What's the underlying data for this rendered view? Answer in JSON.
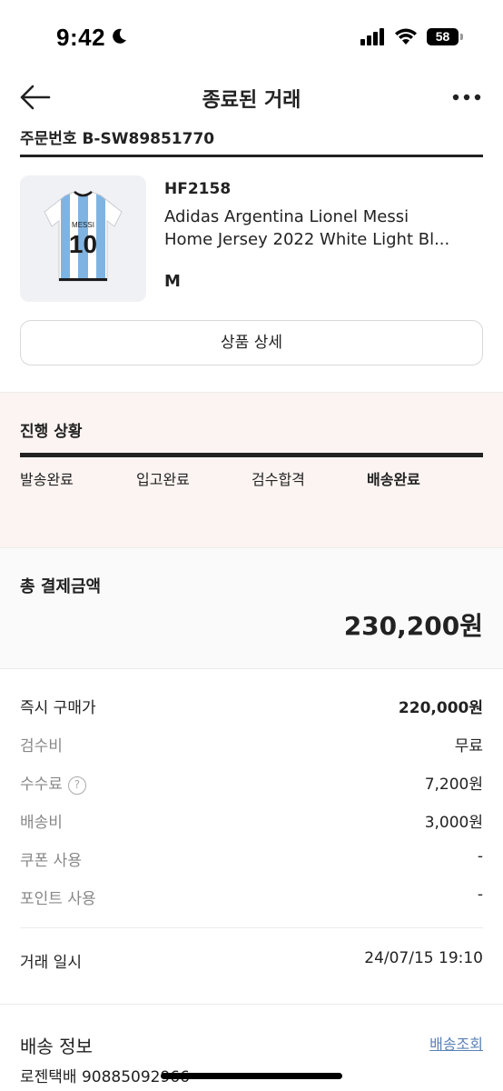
{
  "status_bar": {
    "time": "9:42",
    "battery": "58"
  },
  "header": {
    "title": "종료된 거래",
    "back_icon": "arrow-left-icon",
    "more_icon": "more-horizontal-icon"
  },
  "order": {
    "number_label": "주문번호 B-SW89851770"
  },
  "product": {
    "code": "HF2158",
    "name_line1": "Adidas Argentina Lionel Messi",
    "name_line2": "Home Jersey 2022 White Light Bl...",
    "size": "M",
    "jersey_name": "MESSI",
    "jersey_number": "10",
    "detail_button": "상품 상세"
  },
  "progress": {
    "title": "진행 상황",
    "steps": [
      "발송완료",
      "입고완료",
      "검수합격",
      "배송완료"
    ],
    "active_step": "배송완료"
  },
  "payment": {
    "total_label": "총 결제금액",
    "total_amount": "230,200원",
    "rows": [
      {
        "label": "즉시 구매가",
        "value": "220,000원"
      },
      {
        "label": "검수비",
        "value": "무료"
      },
      {
        "label": "수수료",
        "value": "7,200원"
      },
      {
        "label": "배송비",
        "value": "3,000원"
      },
      {
        "label": "쿠폰 사용",
        "value": "-"
      },
      {
        "label": "포인트 사용",
        "value": "-"
      }
    ]
  },
  "trade": {
    "label": "거래 일시",
    "value": "24/07/15 19:10"
  },
  "delivery": {
    "title": "배송 정보",
    "link": "배송조회",
    "info": "로젠택배 90885092966"
  },
  "colors": {
    "accent_link": "#5a82b5",
    "progress_bg": "#fcf4f2",
    "jersey_blue": "#7fb4e2"
  }
}
